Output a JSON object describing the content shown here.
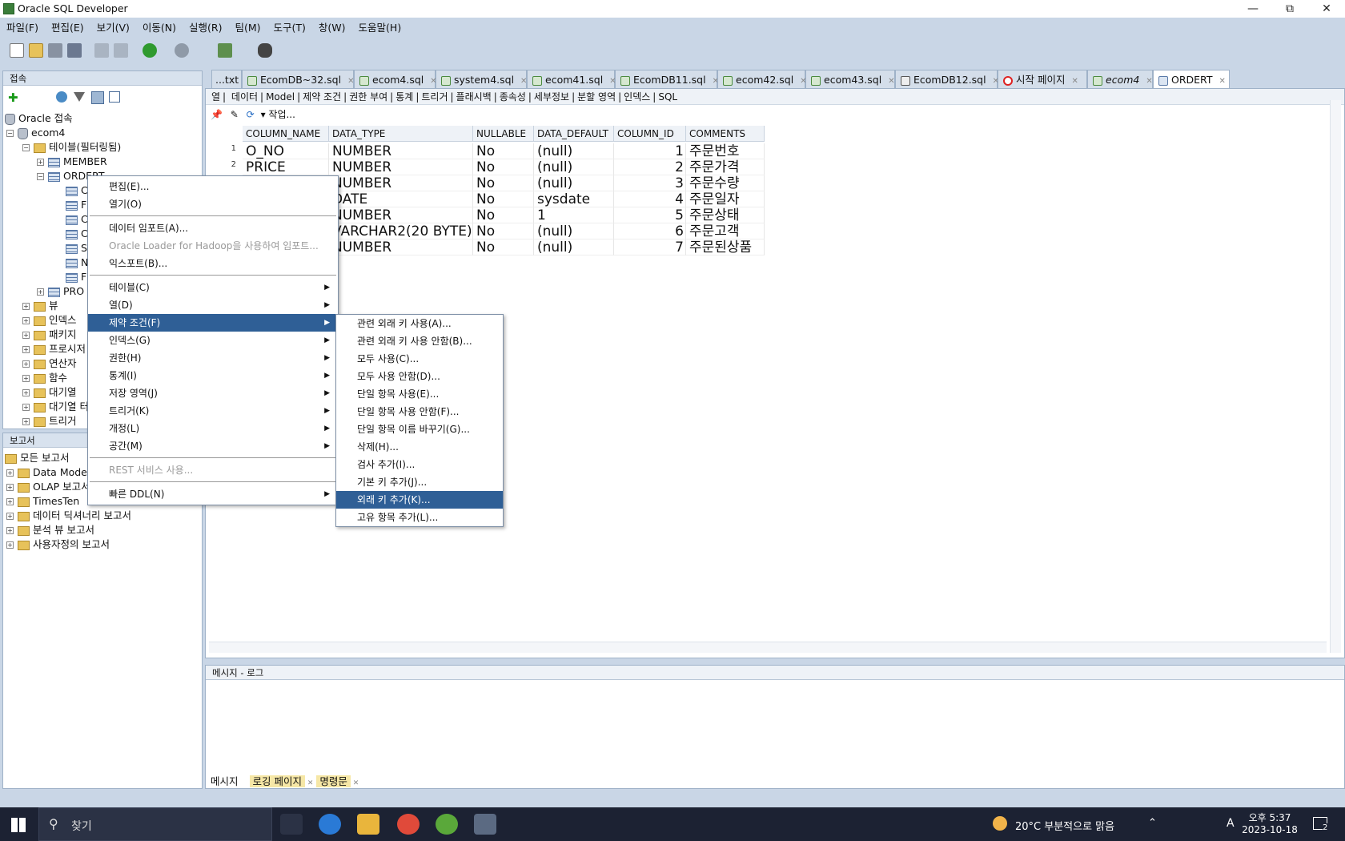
{
  "window": {
    "title": "Oracle SQL Developer"
  },
  "menubar": [
    "파일(F)",
    "편집(E)",
    "보기(V)",
    "이동(N)",
    "실행(R)",
    "팀(M)",
    "도구(T)",
    "창(W)",
    "도움말(H)"
  ],
  "connections": {
    "header": "접속",
    "root": "Oracle 접속",
    "conn": "ecom4",
    "tables": "테이블(필터링됨)",
    "t_member": "MEMBER",
    "t_ordert": "ORDERT",
    "t_prod": "PRO",
    "cols_partial": [
      "C",
      "F",
      "C",
      "C",
      "S",
      "N",
      "F"
    ],
    "nodes": [
      "뷰",
      "인덱스",
      "패키지",
      "프로시저",
      "연산자",
      "함수",
      "대기열",
      "대기열 터",
      "트리거"
    ]
  },
  "reports": {
    "header": "보고서",
    "items": [
      "모든 보고서",
      "Data Model",
      "OLAP 보고서",
      "TimesTen",
      "데이터 딕셔너리 보고서",
      "분석 뷰 보고서",
      "사용자정의 보고서"
    ]
  },
  "tabs": [
    {
      "label": "...txt"
    },
    {
      "label": "EcomDB~32.sql"
    },
    {
      "label": "ecom4.sql"
    },
    {
      "label": "system4.sql"
    },
    {
      "label": "ecom41.sql"
    },
    {
      "label": "EcomDB11.sql"
    },
    {
      "label": "ecom42.sql"
    },
    {
      "label": "ecom43.sql"
    },
    {
      "label": "EcomDB12.sql"
    },
    {
      "label": "시작 페이지"
    },
    {
      "label": "ecom4"
    },
    {
      "label": "ORDERT"
    }
  ],
  "subtabs": [
    "열",
    "데이터",
    "Model",
    "제약 조건",
    "권한 부여",
    "통계",
    "트리거",
    "플래시백",
    "종속성",
    "세부정보",
    "분할 영역",
    "인덱스",
    "SQL"
  ],
  "actions_label": "작업...",
  "grid": {
    "headers": [
      "COLUMN_NAME",
      "DATA_TYPE",
      "NULLABLE",
      "DATA_DEFAULT",
      "COLUMN_ID",
      "COMMENTS"
    ],
    "rows": [
      [
        "O_NO",
        "NUMBER",
        "No",
        "(null)",
        "1",
        "주문번호"
      ],
      [
        "PRICE",
        "NUMBER",
        "No",
        "(null)",
        "2",
        "주문가격"
      ],
      [
        "",
        "NUMBER",
        "No",
        "(null)",
        "3",
        "주문수량"
      ],
      [
        "",
        "DATE",
        "No",
        "sysdate",
        "4",
        "주문일자"
      ],
      [
        "",
        "NUMBER",
        "No",
        "1",
        "5",
        "주문상태"
      ],
      [
        "",
        "VARCHAR2(20 BYTE)",
        "No",
        "(null)",
        "6",
        "주문고객"
      ],
      [
        "",
        "NUMBER",
        "No",
        "(null)",
        "7",
        "주문된상품"
      ]
    ]
  },
  "context_menu": {
    "items": [
      "편집(E)...",
      "열기(O)",
      "데이터 임포트(A)...",
      "Oracle Loader for Hadoop을 사용하여 임포트...",
      "익스포트(B)...",
      "테이블(C)",
      "열(D)",
      "제약 조건(F)",
      "인덱스(G)",
      "권한(H)",
      "통계(I)",
      "저장 영역(J)",
      "트리거(K)",
      "개정(L)",
      "공간(M)",
      "REST 서비스 사용...",
      "빠른 DDL(N)"
    ]
  },
  "sub_menu": {
    "items": [
      "관련 외래 키 사용(A)...",
      "관련 외래 키 사용 안함(B)...",
      "모두 사용(C)...",
      "모두 사용 안함(D)...",
      "단일 항목 사용(E)...",
      "단일 항목 사용 안함(F)...",
      "단일 항목 이름 바꾸기(G)...",
      "삭제(H)...",
      "검사 추가(I)...",
      "기본 키 추가(J)...",
      "외래 키 추가(K)...",
      "고유 항목 추가(L)..."
    ]
  },
  "log": {
    "title": "메시지 - 로그",
    "tabs": [
      "메시지",
      "로깅 페이지",
      "명령문"
    ]
  },
  "taskbar": {
    "search": "찾기",
    "weather": "20°C  부분적으로 맑음",
    "time": "오후 5:37",
    "date": "2023-10-18",
    "notif_count": "2",
    "lang": "A"
  }
}
